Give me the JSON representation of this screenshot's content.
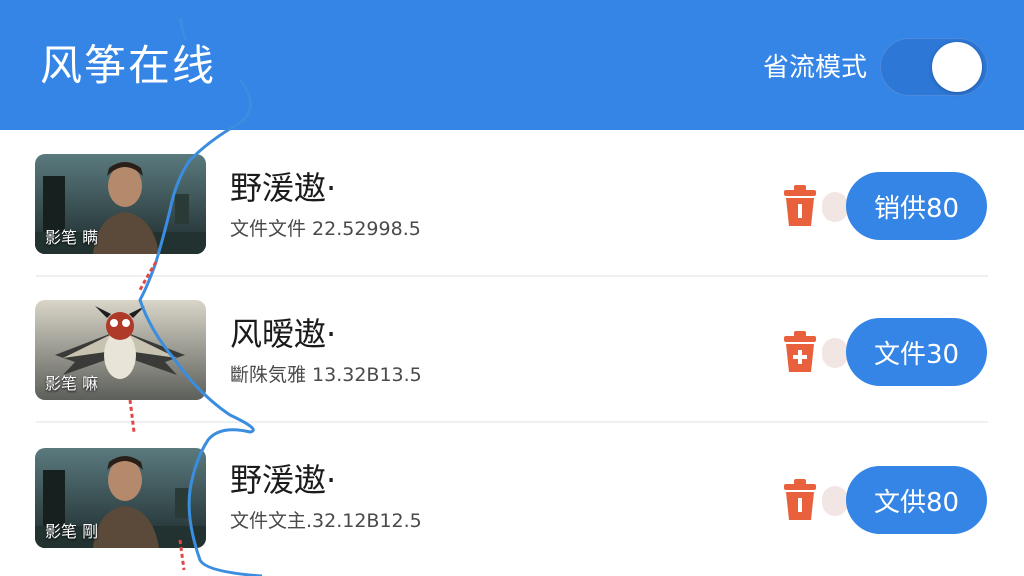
{
  "header": {
    "title": "风筝在线",
    "mode_label": "省流模式",
    "mode_on": true
  },
  "items": [
    {
      "title": "野湲遨·",
      "subtitle": "文件文件 22.52998.5",
      "thumb_caption": "影笔 瞒",
      "button_label": "销供80",
      "thumb_icon": "man-portrait-thumbnail"
    },
    {
      "title": "风暧遨·",
      "subtitle": "斷陎気雅 13.32B13.5",
      "thumb_caption": "影笔 嘛",
      "button_label": "文件30",
      "thumb_icon": "kite-thumbnail"
    },
    {
      "title": "野湲遨·",
      "subtitle": "文件文主.32.12B12.5",
      "thumb_caption": "影笔 剛",
      "button_label": "文供80",
      "thumb_icon": "man-portrait-thumbnail"
    }
  ],
  "colors": {
    "primary": "#3485e6",
    "trash": "#e8603c",
    "string_blue": "#3b8de0",
    "string_red": "#e04848"
  }
}
